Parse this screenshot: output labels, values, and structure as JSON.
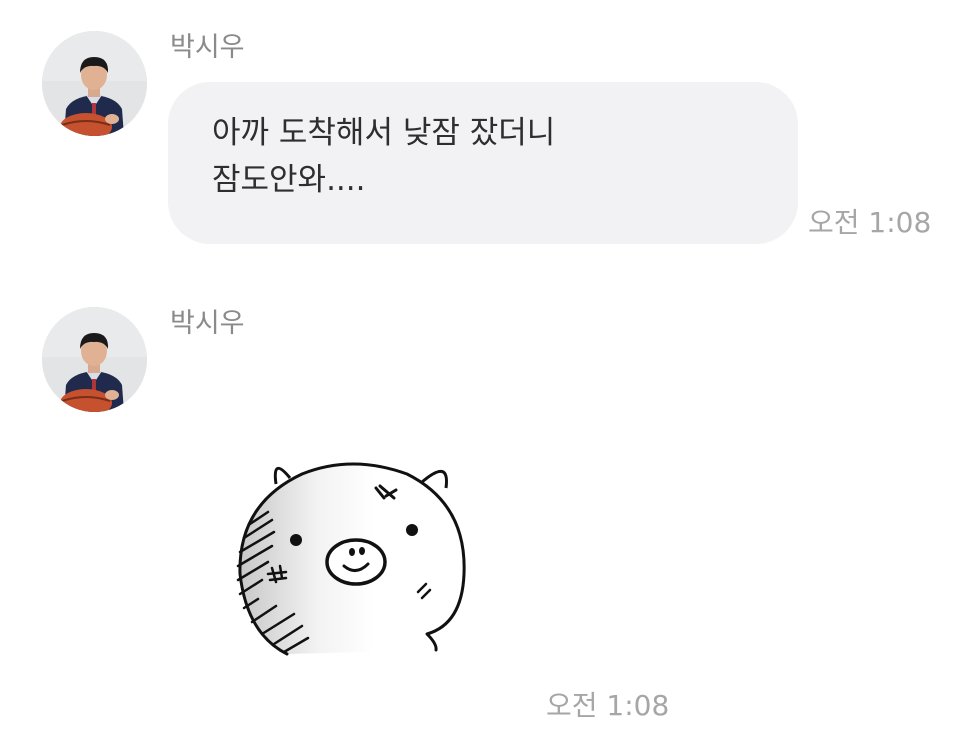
{
  "messages": [
    {
      "sender": "박시우",
      "text_lines": [
        "아까 도착해서 낮잠 잤더니",
        "잠도안와...."
      ],
      "time": "오전 1:08"
    },
    {
      "sender": "박시우",
      "sticker": "pig-sticker",
      "time": "오전 1:08"
    }
  ]
}
